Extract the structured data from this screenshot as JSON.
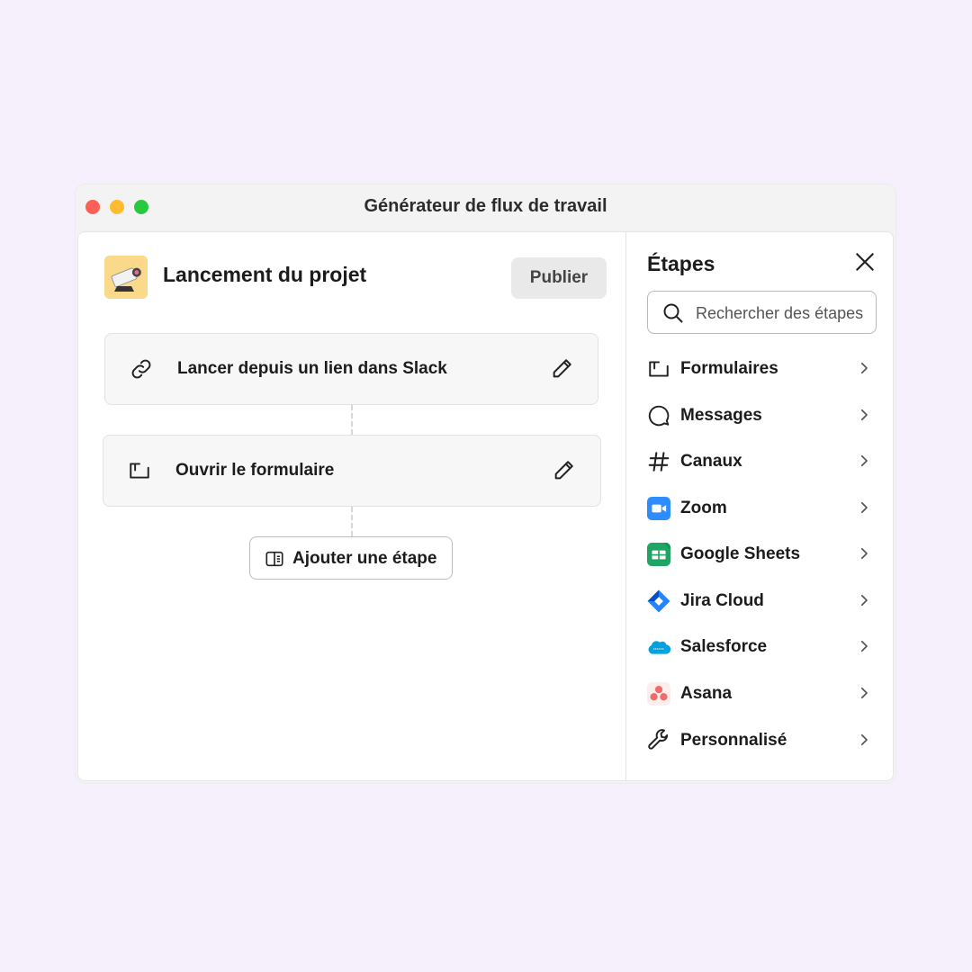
{
  "window": {
    "title": "Générateur de flux de travail"
  },
  "workflow": {
    "name": "Lancement du projet",
    "publish_label": "Publier",
    "steps": [
      {
        "label": "Lancer depuis un lien dans Slack",
        "icon": "link-icon"
      },
      {
        "label": "Ouvrir le formulaire",
        "icon": "form-icon"
      }
    ],
    "add_step_label": "Ajouter une étape"
  },
  "sidebar": {
    "title": "Étapes",
    "search_placeholder": "Rechercher des étapes",
    "items": [
      {
        "label": "Formulaires",
        "icon": "form-icon"
      },
      {
        "label": "Messages",
        "icon": "message-bubble-icon"
      },
      {
        "label": "Canaux",
        "icon": "hash-icon"
      },
      {
        "label": "Zoom",
        "icon": "zoom-logo-icon",
        "color": "#2d8cff"
      },
      {
        "label": "Google Sheets",
        "icon": "google-sheets-icon",
        "color": "#20a464"
      },
      {
        "label": "Jira Cloud",
        "icon": "jira-logo-icon",
        "color": "#2684ff"
      },
      {
        "label": "Salesforce",
        "icon": "salesforce-cloud-icon",
        "color": "#00a1e0"
      },
      {
        "label": "Asana",
        "icon": "asana-logo-icon",
        "color": "#f06a6a"
      },
      {
        "label": "Personnalisé",
        "icon": "wrench-icon"
      }
    ]
  },
  "colors": {
    "background": "#f6f0fc",
    "close": "#fe5f57",
    "minimize": "#febc2e",
    "zoom": "#28c840"
  }
}
